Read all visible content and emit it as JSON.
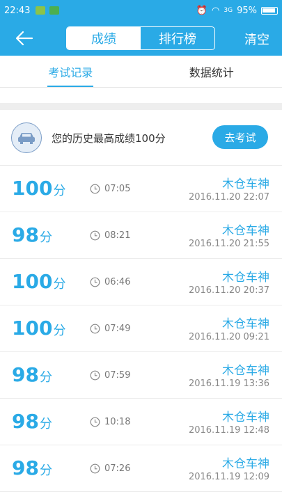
{
  "status": {
    "time": "22:43",
    "battery": "95%",
    "signal": "3G"
  },
  "header": {
    "tabs": [
      {
        "label": "成绩"
      },
      {
        "label": "排行榜"
      }
    ],
    "clear_label": "清空"
  },
  "sub_tabs": [
    {
      "label": "考试记录"
    },
    {
      "label": "数据统计"
    }
  ],
  "best": {
    "text": "您的历史最高成绩100分",
    "button": "去考试"
  },
  "records": [
    {
      "score": "100",
      "unit": "分",
      "duration": "07:05",
      "name": "木仓车神",
      "date": "2016.11.20  22:07"
    },
    {
      "score": "98",
      "unit": "分",
      "duration": "08:21",
      "name": "木仓车神",
      "date": "2016.11.20  21:55"
    },
    {
      "score": "100",
      "unit": "分",
      "duration": "06:46",
      "name": "木仓车神",
      "date": "2016.11.20  20:37"
    },
    {
      "score": "100",
      "unit": "分",
      "duration": "07:49",
      "name": "木仓车神",
      "date": "2016.11.20  09:21"
    },
    {
      "score": "98",
      "unit": "分",
      "duration": "07:59",
      "name": "木仓车神",
      "date": "2016.11.19  13:36"
    },
    {
      "score": "98",
      "unit": "分",
      "duration": "10:18",
      "name": "木仓车神",
      "date": "2016.11.19  12:48"
    },
    {
      "score": "98",
      "unit": "分",
      "duration": "07:26",
      "name": "木仓车神",
      "date": "2016.11.19  12:09"
    }
  ],
  "colors": {
    "accent": "#2aaae6"
  }
}
